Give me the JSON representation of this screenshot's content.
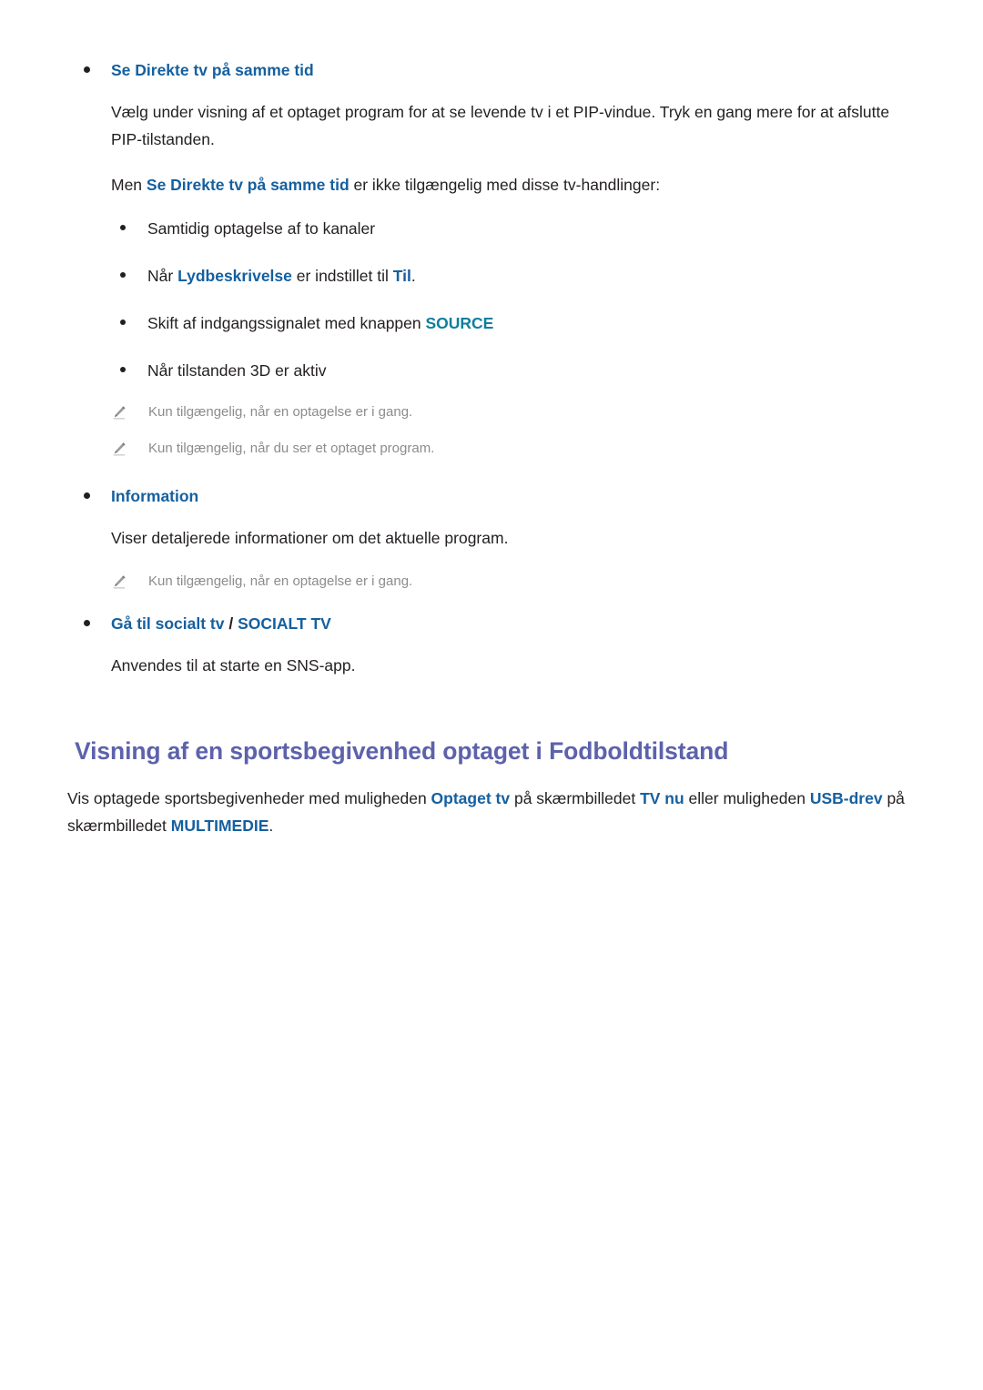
{
  "page": {
    "language": "da",
    "colors": {
      "body_text": "#231f20",
      "term_blue": "#15609f",
      "term_teal": "#0e7f9e",
      "heading_purple": "#5d62ab",
      "note_grey": "#8c8c8c",
      "background": "#ffffff"
    }
  },
  "sections": {
    "live_tv_same_time": {
      "bullet_title": "Se Direkte tv på samme tid",
      "description": "Vælg under visning af et optaget program for at se levende tv i et PIP-vindue. Tryk en gang mere for at afslutte PIP-tilstanden.",
      "restriction_intro": {
        "lead": "Men ",
        "term": "Se Direkte tv på samme tid",
        "tail": " er ikke tilgængelig med disse tv-handlinger:"
      },
      "restrictions": [
        {
          "id": "simultaneous-recording",
          "text": "Samtidig optagelse af to kanaler"
        },
        {
          "id": "audio-description",
          "lead": "Når ",
          "term": "Lydbeskrivelse",
          "mid": " er indstillet til ",
          "term2": "Til",
          "tail": "."
        },
        {
          "id": "source-button",
          "lead": "Skift af indgangssignalet med knappen ",
          "term": "SOURCE",
          "tail": ""
        },
        {
          "id": "3d-mode",
          "text": "Når tilstanden 3D er aktiv"
        }
      ],
      "notes": [
        "Kun tilgængelig, når en optagelse er i gang.",
        "Kun tilgængelig, når du ser et optaget program."
      ]
    },
    "information": {
      "bullet_title": "Information",
      "description": "Viser detaljerede informationer om det aktuelle program.",
      "notes": [
        "Kun tilgængelig, når en optagelse er i gang."
      ]
    },
    "social_tv": {
      "bullet_title_part1": "Gå til socialt tv",
      "bullet_title_separator": " / ",
      "bullet_title_part2": "SOCIALT TV",
      "description": "Anvendes til at starte en SNS-app."
    }
  },
  "heading_section": {
    "title": "Visning af en sportsbegivenhed optaget i Fodboldtilstand",
    "paragraph": {
      "p1": "Vis optagede sportsbegivenheder med muligheden ",
      "t1": "Optaget tv",
      "p2": " på skærmbilledet ",
      "t2": "TV nu",
      "p3": " eller muligheden ",
      "t3": "USB-drev",
      "p4": " på skærmbilledet ",
      "t4": "MULTIMEDIE",
      "p5": "."
    }
  },
  "icons": {
    "note_pencil": "pencil-icon",
    "bullet": "bullet-dot-icon"
  }
}
